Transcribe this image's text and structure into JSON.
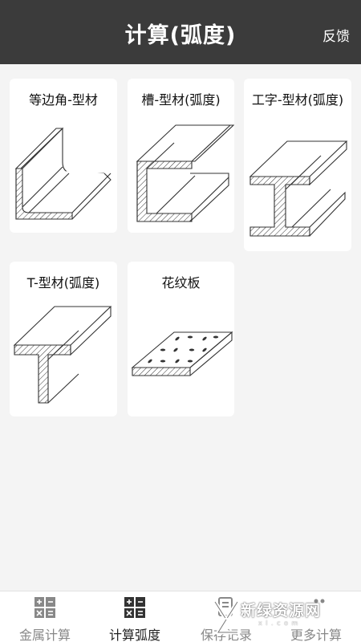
{
  "header": {
    "title": "计算(弧度)",
    "feedback": "反馈"
  },
  "cards": [
    {
      "label": "等边角-型材"
    },
    {
      "label": "槽-型材(弧度)"
    },
    {
      "label": "工字-型材(弧度)"
    },
    {
      "label": "T-型材(弧度)"
    },
    {
      "label": "花纹板"
    }
  ],
  "tabs": [
    {
      "label": "金属计算",
      "active": false,
      "icon": "calculator-icon"
    },
    {
      "label": "计算弧度",
      "active": true,
      "icon": "calculator-icon"
    },
    {
      "label": "保存记录",
      "active": false,
      "icon": "record-icon"
    },
    {
      "label": "更多计算",
      "active": false,
      "icon": "more-icon"
    }
  ],
  "watermark": {
    "text": "新绿资源网",
    "url": "x l . c o m"
  }
}
